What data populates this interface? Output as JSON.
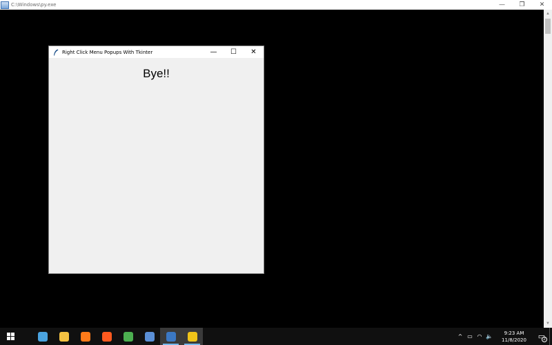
{
  "console": {
    "title": "C:\\Windows\\py.exe",
    "controls": {
      "minimize": "—",
      "restore": "❐",
      "close": "✕"
    }
  },
  "tk_window": {
    "title": "Right Click Menu Popups With Tkinter",
    "controls": {
      "minimize": "—",
      "maximize": "☐",
      "close": "✕"
    },
    "label_text": "Bye!!"
  },
  "taskbar": {
    "apps": [
      {
        "name": "Snipping / Paint tool",
        "color": "#4aa3df",
        "active": false
      },
      {
        "name": "File Explorer",
        "color": "#f5c242",
        "active": false
      },
      {
        "name": "Sublime Text",
        "color": "#ff7b1a",
        "active": false
      },
      {
        "name": "Firefox",
        "color": "#ff5a1f",
        "active": false
      },
      {
        "name": "Google Chrome",
        "color": "#4caf50",
        "active": false
      },
      {
        "name": "Python IDLE",
        "color": "#5a8fd6",
        "active": false
      },
      {
        "name": "Python (py.exe)",
        "color": "#3b78c4",
        "active": true
      },
      {
        "name": "Python (Tkinter)",
        "color": "#f0c419",
        "active": true
      }
    ],
    "tray": {
      "chevron": "^",
      "battery": "▭",
      "network": "◠",
      "volume": "🔈",
      "time": "9:23 AM",
      "date": "11/8/2020",
      "notification_count": "2"
    }
  }
}
